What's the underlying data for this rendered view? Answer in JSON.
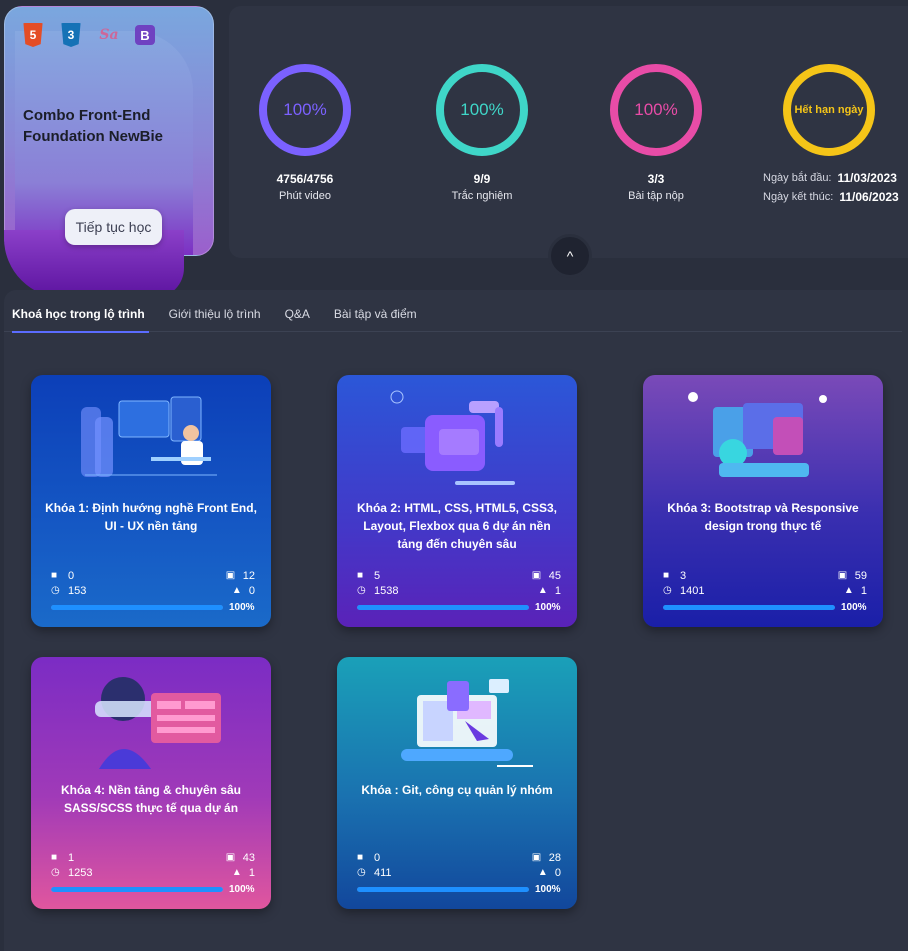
{
  "hero": {
    "title": "Combo Front-End Foundation NewBie",
    "continue_label": "Tiếp tục học",
    "tech_icons": [
      "html5-icon",
      "css3-icon",
      "sass-icon",
      "bootstrap-icon"
    ]
  },
  "stats": [
    {
      "percent": "100%",
      "value": "4756/4756",
      "label": "Phút video",
      "color": "#7b61ff",
      "fraction": 1.0
    },
    {
      "percent": "100%",
      "value": "9/9",
      "label": "Trắc nghiệm",
      "color": "#3fd6c8",
      "fraction": 1.0
    },
    {
      "percent": "100%",
      "value": "3/3",
      "label": "Bài tập nộp",
      "color": "#e84ca7",
      "fraction": 1.0
    }
  ],
  "expiry": {
    "status": "Hết hạn ngày",
    "color": "#f5c518",
    "start_label": "Ngày bắt đầu:",
    "start_date": "11/03/2023",
    "end_label": "Ngày kết thúc:",
    "end_date": "11/06/2023"
  },
  "tabs": [
    {
      "label": "Khoá học trong lộ trình",
      "active": true
    },
    {
      "label": "Giới thiệu lộ trình",
      "active": false
    },
    {
      "label": "Q&A",
      "active": false
    },
    {
      "label": "Bài tập và điểm",
      "active": false
    }
  ],
  "courses": [
    {
      "title": "Khóa 1: Định hướng nghề Front End, UI - UX nền tảng",
      "exercises": "0",
      "lessons": "12",
      "minutes": "153",
      "projects": "0",
      "progress": "100%",
      "progress_value": 1.0
    },
    {
      "title": "Khóa 2: HTML, CSS, HTML5, CSS3, Layout, Flexbox qua 6 dự án nền tảng đến chuyên sâu",
      "exercises": "5",
      "lessons": "45",
      "minutes": "1538",
      "projects": "1",
      "progress": "100%",
      "progress_value": 1.0
    },
    {
      "title": "Khóa 3: Bootstrap và Responsive design trong thực tế",
      "exercises": "3",
      "lessons": "59",
      "minutes": "1401",
      "projects": "1",
      "progress": "100%",
      "progress_value": 1.0
    },
    {
      "title": "Khóa 4: Nền tảng & chuyên sâu SASS/SCSS thực tế qua dự án",
      "exercises": "1",
      "lessons": "43",
      "minutes": "1253",
      "projects": "1",
      "progress": "100%",
      "progress_value": 1.0
    },
    {
      "title": "Khóa : Git, công cụ quản lý nhóm",
      "exercises": "0",
      "lessons": "28",
      "minutes": "411",
      "projects": "0",
      "progress": "100%",
      "progress_value": 1.0
    }
  ]
}
